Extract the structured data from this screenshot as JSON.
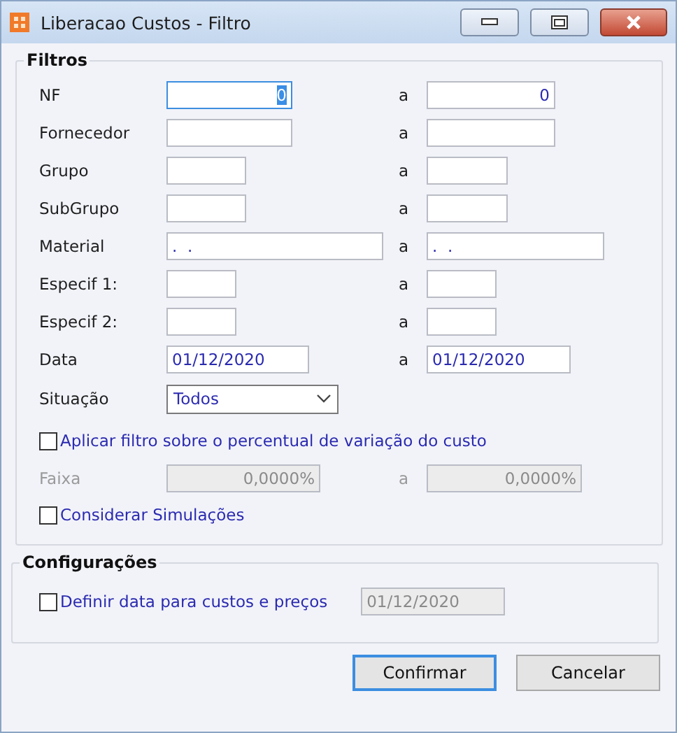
{
  "window": {
    "title": "Liberacao Custos - Filtro"
  },
  "filtros": {
    "title": "Filtros",
    "rows": [
      {
        "label": "NF",
        "from": {
          "value": "0",
          "focused": true
        },
        "separator": "a",
        "to": {
          "value": "0",
          "focused": false
        }
      },
      {
        "label": "Fornecedor",
        "from": {
          "focused": false
        },
        "separator": "a",
        "to": {
          "focused": false
        }
      },
      {
        "label": "Grupo",
        "from": {
          "focused": false
        },
        "separator": "a",
        "to": {
          "focused": false
        }
      },
      {
        "label": "SubGrupo",
        "from": {
          "focused": false
        },
        "separator": "a",
        "to": {
          "focused": false
        }
      },
      {
        "label": "Material",
        "from": {
          "value": ".  .",
          "focused": false
        },
        "separator": "a",
        "to": {
          "value": ".  .",
          "focused": false
        }
      },
      {
        "label": "Especif 1:",
        "from": {
          "focused": false
        },
        "separator": "a",
        "to": {
          "focused": false
        }
      },
      {
        "label": "Especif 2:",
        "from": {
          "focused": false
        },
        "separator": "a",
        "to": {
          "focused": false
        }
      },
      {
        "label": "Data",
        "from": {
          "value": "01/12/2020",
          "focused": false
        },
        "separator": "a",
        "to": {
          "value": "01/12/2020",
          "focused": false
        }
      }
    ],
    "situacao": {
      "label": "Situação",
      "value": "Todos"
    },
    "percent_checkbox": {
      "label": "Aplicar filtro sobre o percentual de variação do custo",
      "checked": false
    },
    "faixa": {
      "label": "Faixa",
      "from": "0,0000%",
      "separator": "a",
      "to": "0,0000%",
      "disabled": true
    },
    "simulacoes_checkbox": {
      "label": "Considerar Simulações",
      "checked": false
    }
  },
  "configuracoes": {
    "title": "Configurações",
    "checkbox": {
      "label": "Definir data para custos e preços",
      "checked": false
    },
    "date": {
      "value": "01/12/2020",
      "disabled": true
    }
  },
  "buttons": [
    {
      "label": "Confirmar",
      "default": true
    },
    {
      "label": "Cancelar",
      "default": false
    }
  ]
}
